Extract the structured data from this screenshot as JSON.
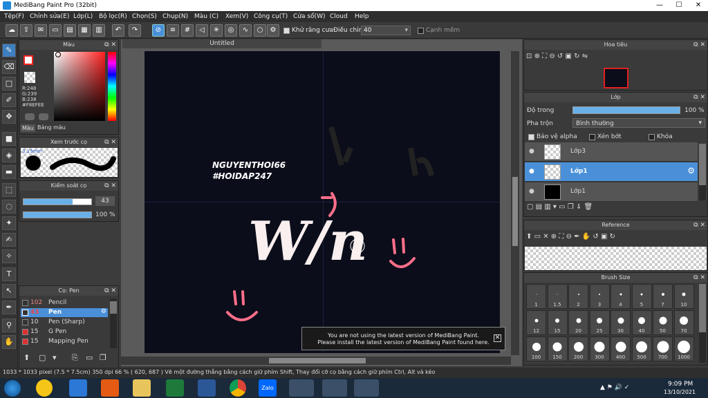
{
  "app": {
    "title": "MediBang Paint Pro (32bit)"
  },
  "menu": [
    "Tệp(F)",
    "Chỉnh sửa(E)",
    "Lớp(L)",
    "Bộ lọc(R)",
    "Chọn(S)",
    "Chụp(N)",
    "Màu (C)",
    "Xem(V)",
    "Công cụ(T)",
    "Cửa sổ(W)",
    "Cloud",
    "Help"
  ],
  "toolbar": {
    "antialias_label": "Khử răng cưa",
    "adjust_label": "Điều chỉnh",
    "adjust_value": "40",
    "sharp_label": "Cạnh mềm"
  },
  "color_panel": {
    "title": "Màu",
    "rgb_r": "R:248",
    "rgb_g": "G:239",
    "rgb_b": "B:238",
    "hex": "#F8EFEE",
    "tab_color": "Màu",
    "tab_palette": "Bảng màu",
    "colors": {
      "fg": "#f8efee",
      "swatch": "#ff2222"
    }
  },
  "preview_panel": {
    "title": "Xem trước cọ",
    "size": "3.19mm"
  },
  "brush_control": {
    "title": "Kiểm soát cọ",
    "size_value": "43",
    "opacity_value": "100 %",
    "size_fraction": 0.72,
    "opacity_fraction": 1.0
  },
  "brush_list": {
    "title": "Cọ: Pen",
    "items": [
      {
        "size": "102",
        "name": "Pencil",
        "color": "#333333"
      },
      {
        "size": "43",
        "name": "Pen",
        "color": "#333333",
        "selected": true
      },
      {
        "size": "10",
        "name": "Pen (Sharp)",
        "color": "#333333"
      },
      {
        "size": "15",
        "name": "G Pen",
        "color": "#e03030"
      },
      {
        "size": "15",
        "name": "Mapping Pen",
        "color": "#e03030"
      }
    ]
  },
  "canvas": {
    "tab": "Untitled",
    "text1": "NGUYENTHOI66",
    "text2": "#HOIDAP247",
    "art_text": "W/n"
  },
  "notice": {
    "line1": "You are not using the latest version of MediBang Paint.",
    "line2": "Please install the latest version of MediBang Paint found here."
  },
  "navigator": {
    "title": "Hoa tiêu"
  },
  "layer": {
    "title": "Lớp",
    "opacity_label": "Độ trong",
    "opacity_value": "100 %",
    "opacity_fraction": 1.0,
    "blend_label": "Pha trộn",
    "blend_value": "Bình thường",
    "protect_label": "Bảo vệ alpha",
    "clip_label": "Xén bớt",
    "lock_label": "Khóa",
    "layers": [
      {
        "name": "Lớp3",
        "selected": false
      },
      {
        "name": "Lớp1",
        "selected": true
      },
      {
        "name": "Lớp1",
        "selected": false
      }
    ]
  },
  "reference": {
    "title": "Reference"
  },
  "brush_size": {
    "title": "Brush Size",
    "sizes": [
      "1",
      "1.5",
      "2",
      "3",
      "4",
      "5",
      "7",
      "10",
      "12",
      "15",
      "20",
      "25",
      "30",
      "40",
      "50",
      "70",
      "100",
      "150",
      "200",
      "300",
      "400",
      "500",
      "700",
      "1000"
    ]
  },
  "statusbar": {
    "text": "1033 * 1033 pixel   (7.5 * 7.5cm)   350 dpi   66 %   ( 620, 687 )   Vẽ một đường thẳng bằng cách giữ phím Shift, Thay đổi cỡ cọ bằng cách giữ phím Ctrl, Alt và kéo"
  },
  "taskbar": {
    "time": "9:09 PM",
    "date": "13/10/2021",
    "zalo_label": "Zalo"
  }
}
